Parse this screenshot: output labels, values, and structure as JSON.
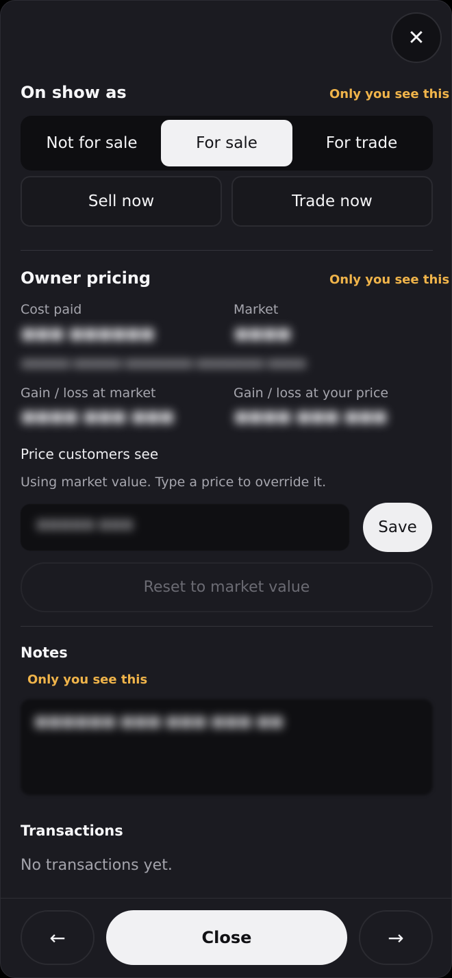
{
  "close_icon_glyph": "✕",
  "on_show": {
    "title": "On show as",
    "hint": "Only you see this",
    "options": [
      "Not for sale",
      "For sale",
      "For trade"
    ],
    "selected": "For sale"
  },
  "actions": {
    "sell_now": "Sell now",
    "trade_now": "Trade now"
  },
  "owner_pricing": {
    "title": "Owner pricing",
    "hint": "Only you see this",
    "cost_paid_label": "Cost paid",
    "market_label": "Market",
    "gain_market_label": "Gain / loss at market",
    "gain_price_label": "Gain / loss at your price"
  },
  "price": {
    "label": "Price customers see",
    "help": "Using market value. Type a price to override it.",
    "save_label": "Save",
    "reset_label": "Reset to market value"
  },
  "notes": {
    "title": "Notes",
    "hint": "Only you see this"
  },
  "transactions": {
    "title": "Transactions",
    "empty": "No transactions yet."
  },
  "footer": {
    "prev_glyph": "←",
    "close_label": "Close",
    "next_glyph": "→"
  },
  "colors": {
    "accent_hint": "#f0b44a",
    "panel_bg": "#1b1b21",
    "active_seg": "#f1f1f3"
  }
}
